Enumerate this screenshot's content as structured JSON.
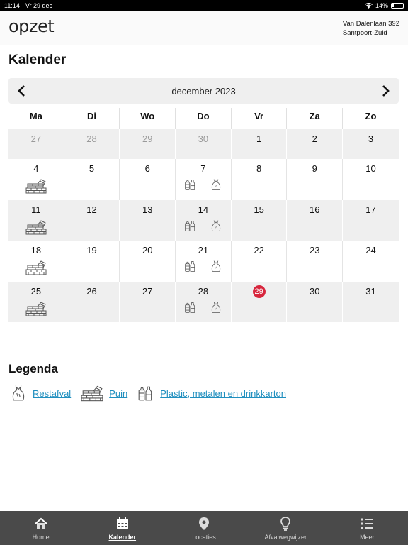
{
  "status_bar": {
    "time": "11:14",
    "date": "Vr 29 dec",
    "battery": "14%"
  },
  "header": {
    "logo": "opzet",
    "address_line1": "Van Dalenlaan 392",
    "address_line2": "Santpoort-Zuid"
  },
  "page": {
    "title": "Kalender"
  },
  "calendar": {
    "month_label": "december 2023",
    "weekdays": [
      "Ma",
      "Di",
      "Wo",
      "Do",
      "Vr",
      "Za",
      "Zo"
    ],
    "weeks": [
      {
        "days": [
          {
            "n": "27",
            "other": true
          },
          {
            "n": "28",
            "other": true
          },
          {
            "n": "29",
            "other": true
          },
          {
            "n": "30",
            "other": true
          },
          {
            "n": "1"
          },
          {
            "n": "2"
          },
          {
            "n": "3"
          }
        ]
      },
      {
        "days": [
          {
            "n": "4",
            "icons": [
              "puin"
            ]
          },
          {
            "n": "5"
          },
          {
            "n": "6"
          },
          {
            "n": "7",
            "icons": [
              "plastic",
              "restafval"
            ]
          },
          {
            "n": "8"
          },
          {
            "n": "9"
          },
          {
            "n": "10"
          }
        ]
      },
      {
        "days": [
          {
            "n": "11",
            "icons": [
              "puin"
            ]
          },
          {
            "n": "12"
          },
          {
            "n": "13"
          },
          {
            "n": "14",
            "icons": [
              "plastic",
              "restafval"
            ]
          },
          {
            "n": "15"
          },
          {
            "n": "16"
          },
          {
            "n": "17"
          }
        ]
      },
      {
        "days": [
          {
            "n": "18",
            "icons": [
              "puin"
            ]
          },
          {
            "n": "19"
          },
          {
            "n": "20"
          },
          {
            "n": "21",
            "icons": [
              "plastic",
              "restafval"
            ]
          },
          {
            "n": "22"
          },
          {
            "n": "23"
          },
          {
            "n": "24"
          }
        ]
      },
      {
        "days": [
          {
            "n": "25",
            "icons": [
              "puin"
            ]
          },
          {
            "n": "26"
          },
          {
            "n": "27"
          },
          {
            "n": "28",
            "icons": [
              "plastic",
              "restafval"
            ]
          },
          {
            "n": "29",
            "today": true
          },
          {
            "n": "30"
          },
          {
            "n": "31"
          }
        ]
      }
    ],
    "today_color": "#d7263d"
  },
  "legend": {
    "title": "Legenda",
    "items": [
      {
        "icon": "restafval",
        "label": "Restafval"
      },
      {
        "icon": "puin",
        "label": "Puin"
      },
      {
        "icon": "plastic",
        "label": "Plastic, metalen en drinkkarton"
      }
    ],
    "link_color": "#1f8fbf"
  },
  "tabbar": {
    "items": [
      {
        "icon": "home-icon",
        "label": "Home"
      },
      {
        "icon": "calendar-icon",
        "label": "Kalender",
        "active": true
      },
      {
        "icon": "location-pin-icon",
        "label": "Locaties"
      },
      {
        "icon": "lightbulb-icon",
        "label": "Afvalwegwijzer"
      },
      {
        "icon": "menu-list-icon",
        "label": "Meer"
      }
    ]
  }
}
